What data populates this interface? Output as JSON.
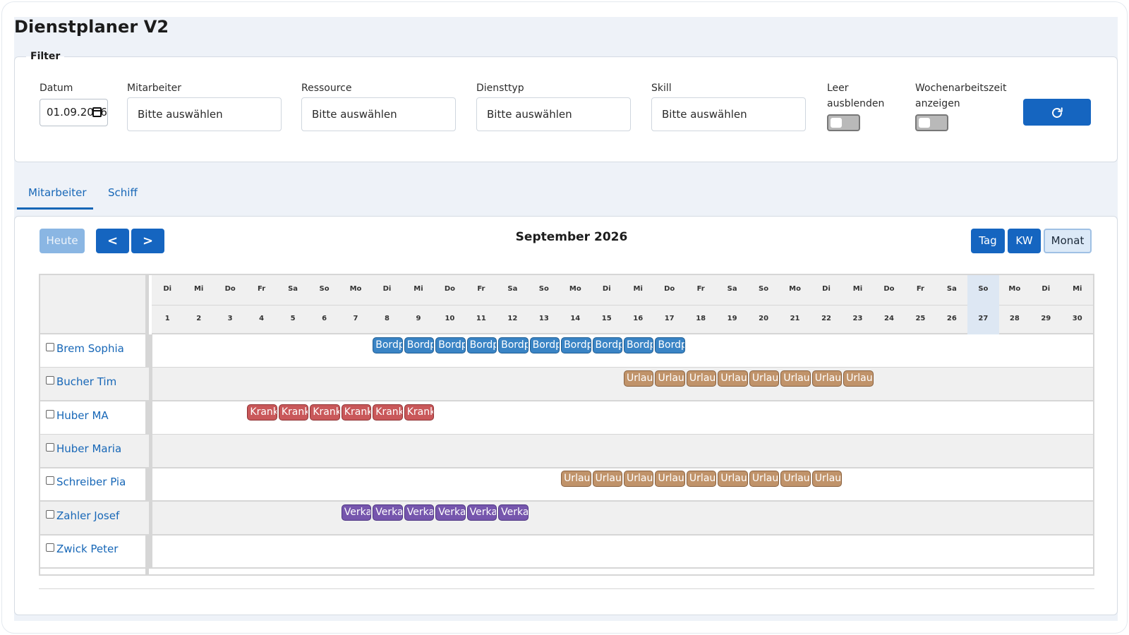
{
  "app": {
    "title": "Dienstplaner V2"
  },
  "filter": {
    "legend": "Filter",
    "datum": {
      "label": "Datum",
      "value": "01.09.2026"
    },
    "mitarbeiter": {
      "label": "Mitarbeiter",
      "placeholder": "Bitte auswählen"
    },
    "ressource": {
      "label": "Ressource",
      "placeholder": "Bitte auswählen"
    },
    "diensttyp": {
      "label": "Diensttyp",
      "placeholder": "Bitte auswählen"
    },
    "skill": {
      "label": "Skill",
      "placeholder": "Bitte auswählen"
    },
    "leer": {
      "label_line1": "Leer",
      "label_line2": "ausblenden",
      "checked": false
    },
    "wochenarbeitszeit": {
      "label_line1": "Wochenarbeitszeit",
      "label_line2": "anzeigen",
      "checked": false
    },
    "refresh_icon": "refresh-icon"
  },
  "tabs": [
    {
      "label": "Mitarbeiter",
      "active": true
    },
    {
      "label": "Schiff",
      "active": false
    }
  ],
  "calendar": {
    "today_label": "Heute",
    "prev_icon": "chevron-left-icon",
    "next_icon": "chevron-right-icon",
    "prev_glyph": "<",
    "next_glyph": ">",
    "title": "September 2026",
    "views": [
      {
        "label": "Tag",
        "active": false
      },
      {
        "label": "KW",
        "active": false
      },
      {
        "label": "Monat",
        "active": true
      }
    ],
    "highlight_day": 27,
    "days": [
      {
        "wd": "Di",
        "d": "1"
      },
      {
        "wd": "Mi",
        "d": "2"
      },
      {
        "wd": "Do",
        "d": "3"
      },
      {
        "wd": "Fr",
        "d": "4"
      },
      {
        "wd": "Sa",
        "d": "5"
      },
      {
        "wd": "So",
        "d": "6"
      },
      {
        "wd": "Mo",
        "d": "7"
      },
      {
        "wd": "Di",
        "d": "8"
      },
      {
        "wd": "Mi",
        "d": "9"
      },
      {
        "wd": "Do",
        "d": "10"
      },
      {
        "wd": "Fr",
        "d": "11"
      },
      {
        "wd": "Sa",
        "d": "12"
      },
      {
        "wd": "So",
        "d": "13"
      },
      {
        "wd": "Mo",
        "d": "14"
      },
      {
        "wd": "Di",
        "d": "15"
      },
      {
        "wd": "Mi",
        "d": "16"
      },
      {
        "wd": "Do",
        "d": "17"
      },
      {
        "wd": "Fr",
        "d": "18"
      },
      {
        "wd": "Sa",
        "d": "19"
      },
      {
        "wd": "So",
        "d": "20"
      },
      {
        "wd": "Mo",
        "d": "21"
      },
      {
        "wd": "Di",
        "d": "22"
      },
      {
        "wd": "Mi",
        "d": "23"
      },
      {
        "wd": "Do",
        "d": "24"
      },
      {
        "wd": "Fr",
        "d": "25"
      },
      {
        "wd": "Sa",
        "d": "26"
      },
      {
        "wd": "So",
        "d": "27"
      },
      {
        "wd": "Mo",
        "d": "28"
      },
      {
        "wd": "Di",
        "d": "29"
      },
      {
        "wd": "Mi",
        "d": "30"
      }
    ],
    "colors": {
      "Bordp": "#3a84c5",
      "Urlau": "#c0936a",
      "Krank": "#c9585a",
      "Verka": "#7656ad"
    },
    "rows": [
      {
        "name": "Brem Sophia",
        "events": [
          {
            "label": "Bordp",
            "start": 8,
            "end": 17,
            "color": "blue"
          }
        ]
      },
      {
        "name": "Bucher Tim",
        "events": [
          {
            "label": "Urlau",
            "start": 16,
            "end": 23,
            "color": "orange"
          }
        ]
      },
      {
        "name": "Huber MA",
        "events": [
          {
            "label": "Krank",
            "start": 4,
            "end": 9,
            "color": "red"
          }
        ]
      },
      {
        "name": "Huber Maria",
        "events": []
      },
      {
        "name": "Schreiber Pia",
        "events": [
          {
            "label": "Urlau",
            "start": 14,
            "end": 22,
            "color": "orange"
          }
        ]
      },
      {
        "name": "Zahler Josef",
        "events": [
          {
            "label": "Verka",
            "start": 7,
            "end": 12,
            "color": "purple"
          }
        ]
      },
      {
        "name": "Zwick Peter",
        "events": []
      }
    ]
  }
}
